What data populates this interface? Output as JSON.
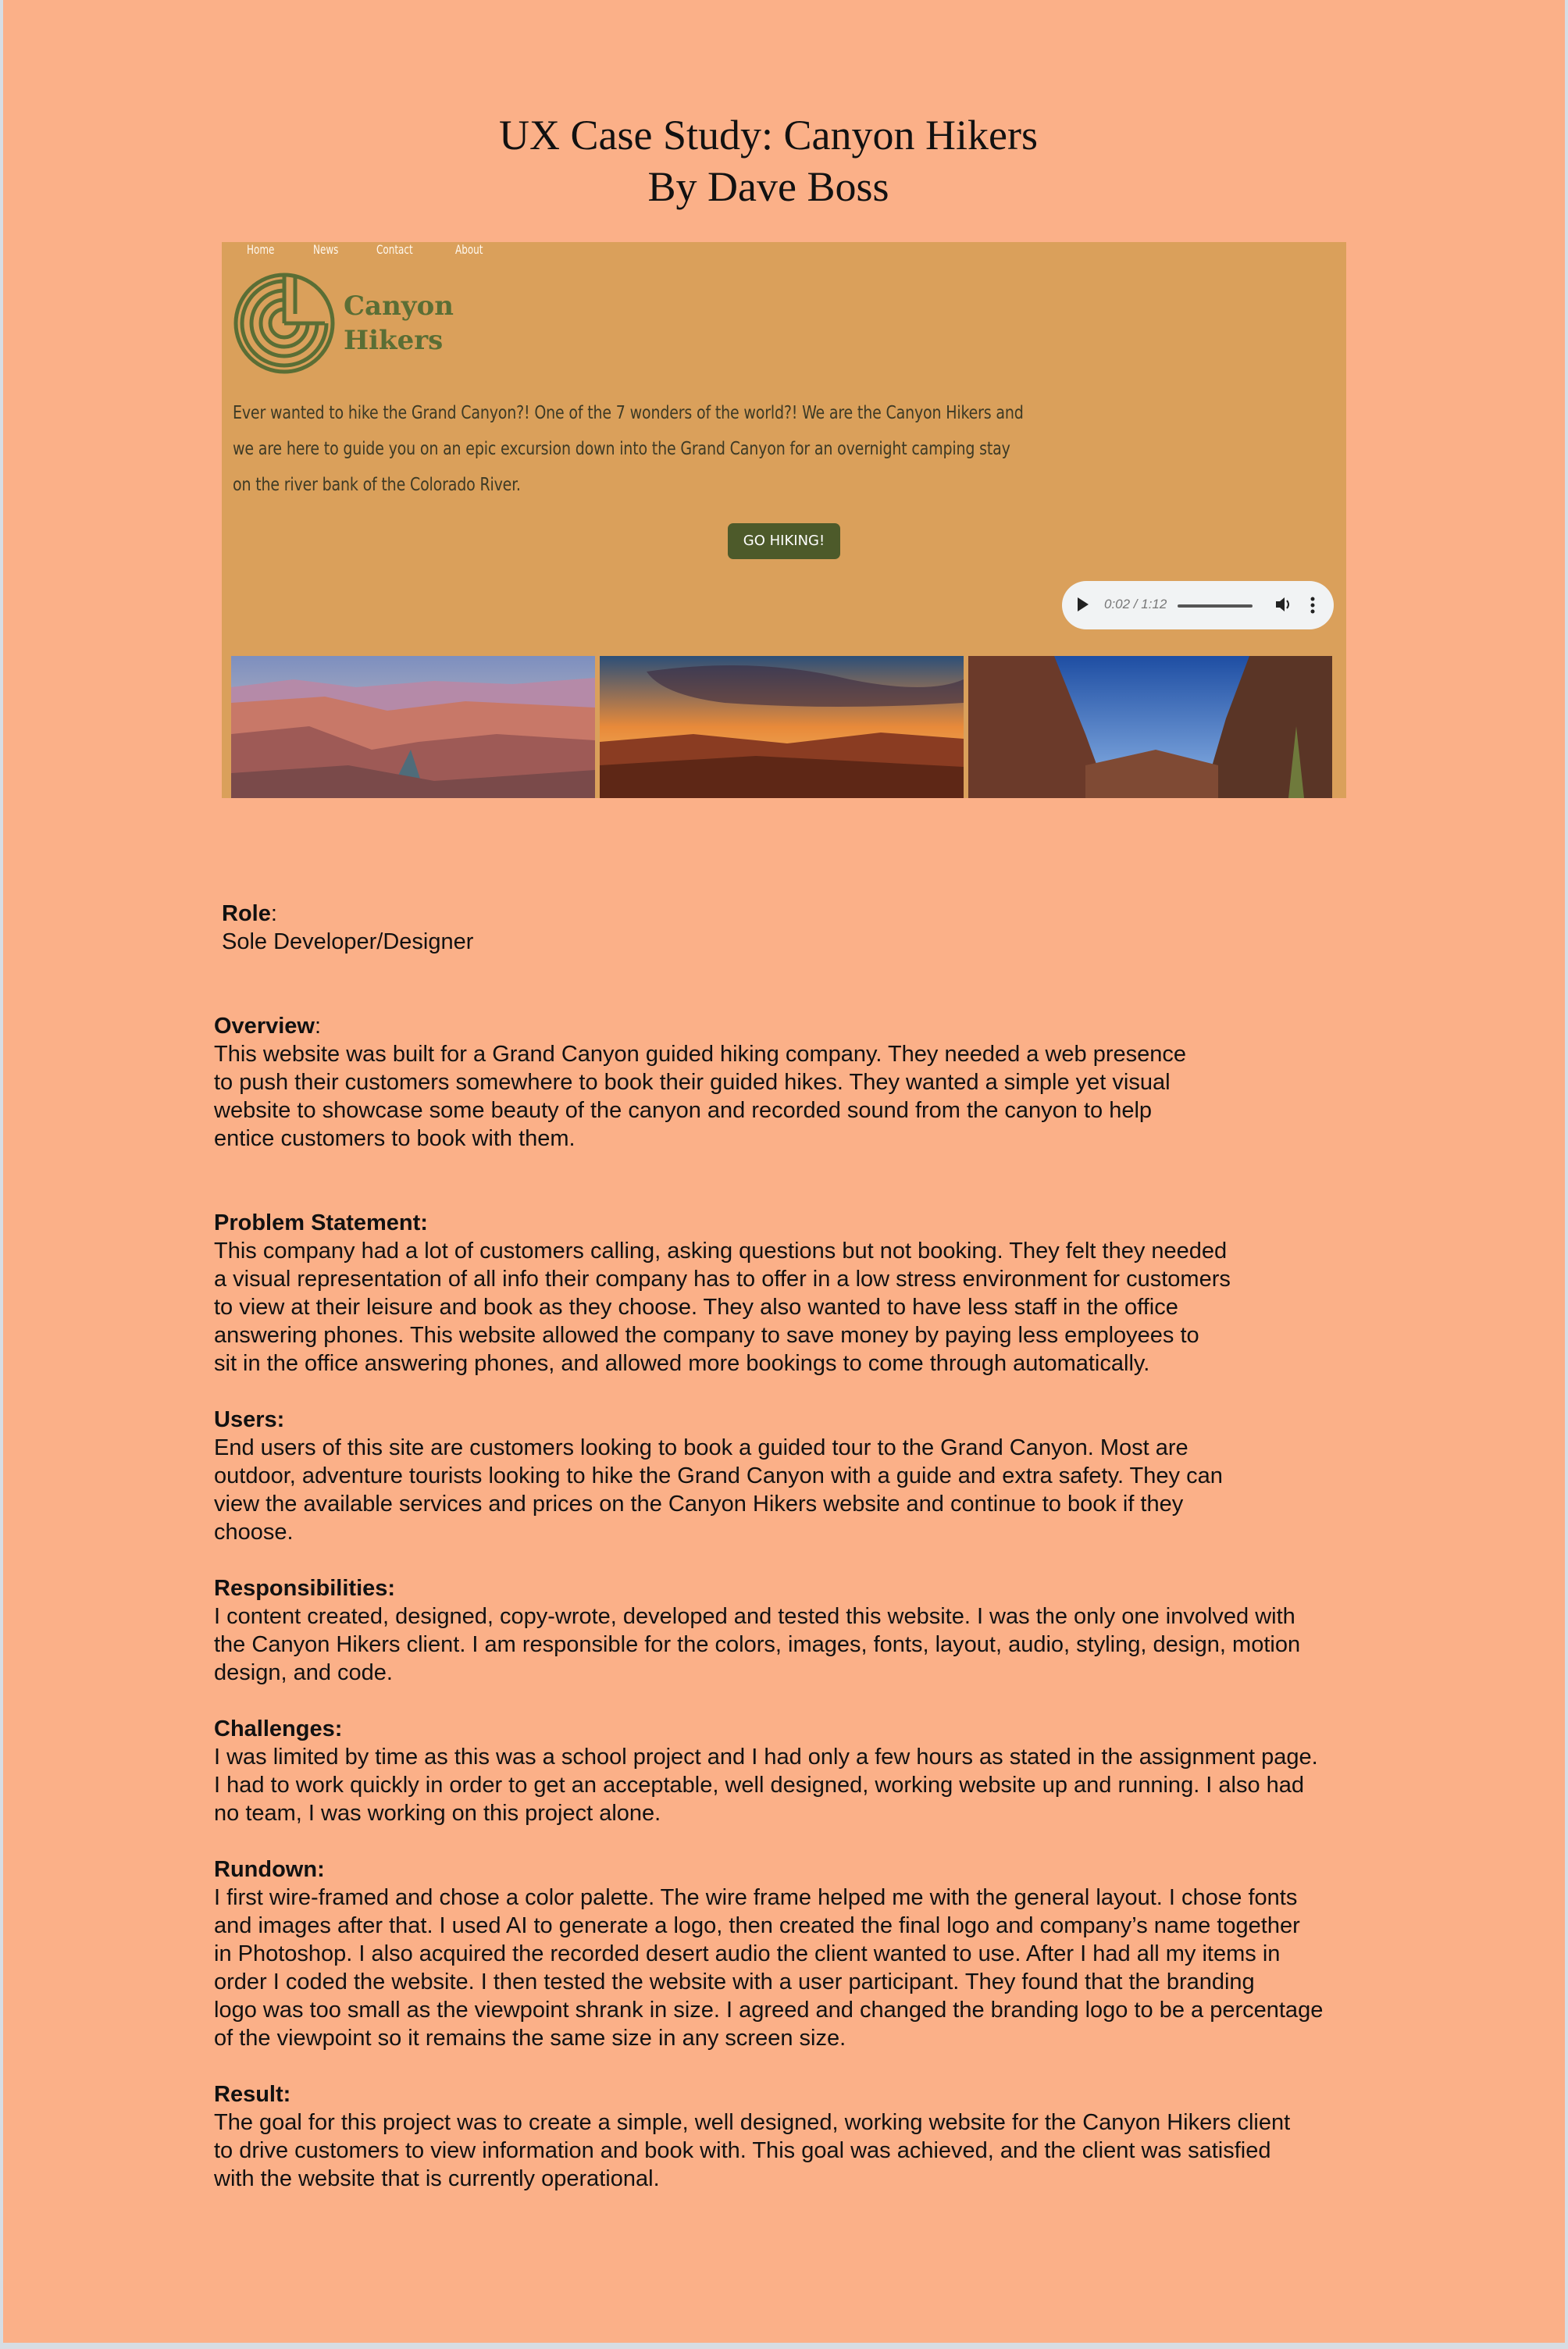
{
  "title": {
    "line1": "UX Case Study: Canyon Hikers",
    "line2": "By Dave Boss"
  },
  "mockup": {
    "nav": [
      "Home",
      "News",
      "Contact",
      "About"
    ],
    "brand_line1": "Canyon",
    "brand_line2": "Hikers",
    "intro": "Ever wanted to hike the Grand Canyon?! One of the 7 wonders of the world?! We are the Canyon Hikers and we are here to guide you on an epic excursion down into the Grand Canyon for an overnight camping stay on the river bank of the Colorado River.",
    "cta": "GO HIKING!",
    "audio_time": "0:02 / 1:12",
    "audio_progress": 0.03,
    "colors": {
      "header_bg": "#daa05b",
      "brand": "#5a6e35",
      "button": "#4d5a2a",
      "page_bg": "#fbb088"
    }
  },
  "role": {
    "heading": "Role",
    "text": "Sole Developer/Designer"
  },
  "overview": {
    "heading": "Overview",
    "text": "This website was built for a Grand Canyon guided hiking company. They needed a web presence\nto push their customers somewhere to book their guided hikes. They wanted a simple yet visual\nwebsite to showcase some beauty of the canyon and recorded sound from the canyon to help\nentice customers to book with them."
  },
  "problem": {
    "heading": "Problem Statement:",
    "text": "This company had a lot of customers calling, asking questions but not booking. They felt they needed\na visual representation of all info their company has to offer in a low stress environment for customers\nto view at their leisure and book as they choose. They also wanted to have less staff in the office\nanswering phones. This website allowed the company to save money by paying less employees to\nsit in the office answering phones, and allowed more bookings to come through automatically."
  },
  "users": {
    "heading": "Users:",
    "text": "End users of this site are customers looking to book a guided tour to the Grand Canyon.  Most are\noutdoor, adventure tourists looking to hike the Grand Canyon with a guide and extra safety. They can\nview the available services and prices on the Canyon Hikers website and continue to book if they\nchoose."
  },
  "responsibilities": {
    "heading": "Responsibilities:",
    "text": "I content created, designed, copy-wrote, developed and tested this website. I was the only one involved with\nthe Canyon Hikers client. I am responsible for the colors, images, fonts, layout, audio, styling, design, motion\ndesign, and code."
  },
  "challenges": {
    "heading": "Challenges:",
    "text": "I was limited by time as this was a school project and I had only a few hours as stated in the assignment page.\nI had to work quickly in order to get an acceptable, well designed, working website up and running. I also had\nno team, I was working on this project alone."
  },
  "rundown": {
    "heading": "Rundown:",
    "text": "I first wire-framed and chose a color palette. The wire frame helped me with the general layout. I chose fonts\nand images after that. I used AI to generate a logo, then created the final logo and company’s name together\nin Photoshop. I also acquired the recorded desert audio the client wanted to use. After I had all my items in\norder I coded the website. I then tested the website with a user participant. They found that the branding\nlogo was too small as the viewpoint shrank in size. I agreed and changed the branding logo to be a percentage\nof the viewpoint so it remains the same size in any screen size."
  },
  "result": {
    "heading": "Result:",
    "text": "The goal for this project was to create a simple, well designed, working website for the Canyon Hikers client\nto drive customers to view information and book with. This goal was achieved, and the client was satisfied\nwith the website that is currently operational."
  }
}
